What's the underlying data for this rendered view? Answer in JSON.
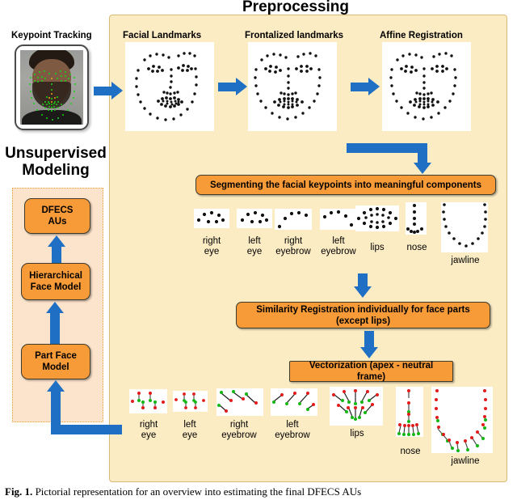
{
  "figure": {
    "preprocessing_title": "Preprocessing",
    "unsupervised_title_line1": "Unsupervised",
    "unsupervised_title_line2": "Modeling",
    "caption_label": "Fig. 1.",
    "caption_text": "Pictorial representation for an overview into estimating the final DFECS AUs"
  },
  "stages": {
    "keypoint_tracking": "Keypoint Tracking",
    "facial_landmarks": "Facial Landmarks",
    "frontalized_landmarks": "Frontalized landmarks",
    "affine_registration": "Affine Registration"
  },
  "process_boxes": {
    "segmenting": "Segmenting the facial keypoints into meaningful components",
    "similarity_line1": "Similarity Registration individually for face parts",
    "similarity_line2": "(except lips)",
    "vectorization": "Vectorization (apex - neutral frame)"
  },
  "model_boxes": {
    "dfecs": "DFECS\nAUs",
    "hierarchical": "Hierarchical\nFace Model",
    "part_face": "Part Face\nModel"
  },
  "segmented_parts": [
    {
      "label": "right\neye",
      "key": "right-eye"
    },
    {
      "label": "left\neye",
      "key": "left-eye"
    },
    {
      "label": "right\neyebrow",
      "key": "right-eyebrow"
    },
    {
      "label": "left\neyebrow",
      "key": "left-eyebrow"
    },
    {
      "label": "lips",
      "key": "lips"
    },
    {
      "label": "nose",
      "key": "nose"
    },
    {
      "label": "jawline",
      "key": "jawline"
    }
  ],
  "vectorized_parts": [
    {
      "label": "right\neye",
      "key": "right-eye"
    },
    {
      "label": "left\neye",
      "key": "left-eye"
    },
    {
      "label": "right\neyebrow",
      "key": "right-eyebrow"
    },
    {
      "label": "left\neyebrow",
      "key": "left-eyebrow"
    },
    {
      "label": "lips",
      "key": "lips"
    },
    {
      "label": "nose",
      "key": "nose"
    },
    {
      "label": "jawline",
      "key": "jawline"
    }
  ],
  "colors": {
    "panel_background": "#fcecc4",
    "panel_border": "#d9b978",
    "process_box": "#f79a38",
    "process_box_border": "#3b3b2e",
    "arrow_blue": "#1f6fc4",
    "group_background": "#fce3cb",
    "group_border": "#e8a33d",
    "landmark_dot": "#000000",
    "vector_start_dot": "#e21b1b",
    "vector_end_dot": "#12b712",
    "keypoint_green": "#15d615",
    "keypoint_orange": "#e5a11c"
  }
}
